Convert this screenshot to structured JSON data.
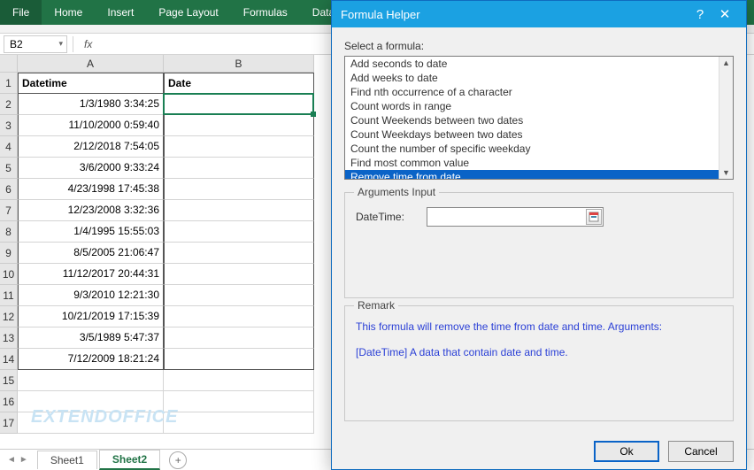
{
  "ribbon": {
    "tabs": [
      "File",
      "Home",
      "Insert",
      "Page Layout",
      "Formulas",
      "Data"
    ]
  },
  "formulaBar": {
    "nameBox": "B2",
    "fx": "fx"
  },
  "sheet": {
    "columns": [
      "A",
      "B"
    ],
    "headerRow": {
      "A": "Datetime",
      "B": "Date"
    },
    "rows": [
      "1/3/1980 3:34:25",
      "11/10/2000 0:59:40",
      "2/12/2018 7:54:05",
      "3/6/2000 9:33:24",
      "4/23/1998 17:45:38",
      "12/23/2008 3:32:36",
      "1/4/1995 15:55:03",
      "8/5/2005 21:06:47",
      "11/12/2017 20:44:31",
      "9/3/2010 12:21:30",
      "10/21/2019 17:15:39",
      "3/5/1989 5:47:37",
      "7/12/2009 18:21:24"
    ],
    "watermark": "EXTENDOFFICE",
    "tabs": {
      "items": [
        "Sheet1",
        "Sheet2"
      ],
      "active": "Sheet2",
      "add": "+"
    }
  },
  "dialog": {
    "title": "Formula Helper",
    "help": "?",
    "close": "✕",
    "selectLabel": "Select a formula:",
    "formulas": [
      "Add seconds to date",
      "Add weeks to date",
      "Find nth occurrence of a character",
      "Count words in range",
      "Count Weekends between two dates",
      "Count Weekdays between two dates",
      "Count the number of specific weekday",
      "Find most common value",
      "Remove time from date"
    ],
    "selected": "Remove time from date",
    "argsLegend": "Arguments Input",
    "argLabel": "DateTime:",
    "argValue": "",
    "remarkLegend": "Remark",
    "remark1": "This formula will remove the time from date and time. Arguments:",
    "remark2": "[DateTime] A data that contain date and time.",
    "ok": "Ok",
    "cancel": "Cancel"
  }
}
